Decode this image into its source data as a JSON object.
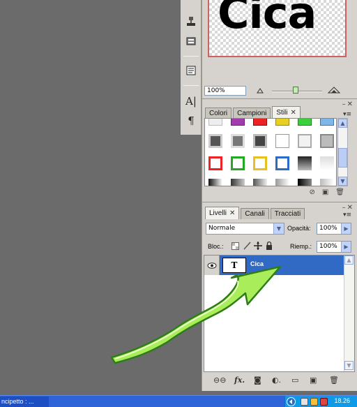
{
  "navigator": {
    "preview_text": "Cica",
    "zoom_value": "100%"
  },
  "tools": [
    {
      "icon": "stamp-icon"
    },
    {
      "icon": "history-brush-icon"
    },
    {
      "icon": "notes-icon"
    },
    {
      "icon": "character-icon",
      "glyph": "A|"
    },
    {
      "icon": "paragraph-icon",
      "glyph": "¶"
    }
  ],
  "styles_panel": {
    "tabs": [
      {
        "label": "Colori",
        "active": false
      },
      {
        "label": "Campioni",
        "active": false
      },
      {
        "label": "Stili",
        "active": true
      }
    ],
    "close_glyph": "✕"
  },
  "layers_panel": {
    "tabs": [
      {
        "label": "Livelli",
        "active": true
      },
      {
        "label": "Canali",
        "active": false
      },
      {
        "label": "Tracciati",
        "active": false
      }
    ],
    "blend_mode": "Normale",
    "opacity_label": "Opacità:",
    "opacity_value": "100%",
    "lock_label": "Bloc.:",
    "fill_label": "Riemp.:",
    "fill_value": "100%",
    "layer": {
      "thumb": "T",
      "name": "Cica"
    }
  },
  "taskbar": {
    "item_label": "ncipetto : ...",
    "clock": "18.26"
  },
  "colors": {
    "panel_bg": "#d6d3ce",
    "workspace_bg": "#6b6b6b",
    "selection": "#316ac5",
    "taskbar": "#2f63d8",
    "arrow_green": "#7ee03a"
  }
}
